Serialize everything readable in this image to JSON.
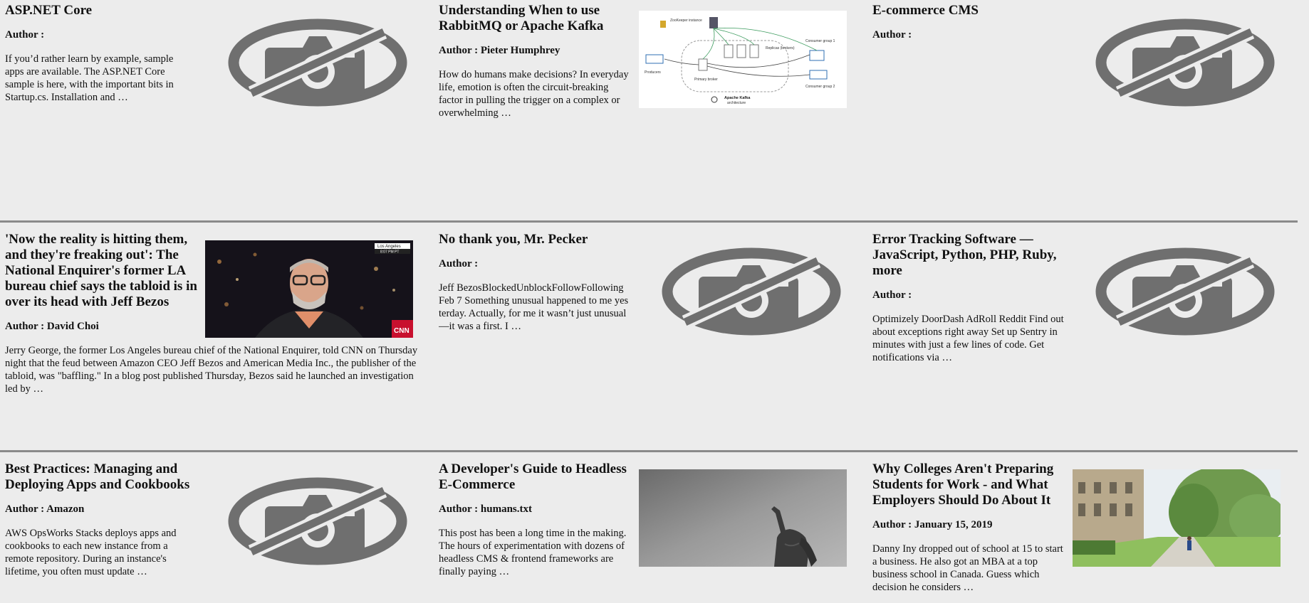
{
  "author_prefix": "Author : ",
  "cards": [
    {
      "title": "ASP.NET Core",
      "author": "Author :",
      "excerpt": "If you’d rather learn by example, sample apps are available. The ASP.NET Core sample is here, with the important bits in Startup.cs. Installation and …",
      "image": "no-photo-icon"
    },
    {
      "title": "Understanding When to use RabbitMQ or Apache Kafka",
      "author": "Author : Pieter Humphrey",
      "excerpt": "How do humans make decisions? In everyday life, emotion is often the circuit-breaking factor in pulling the trigger on a complex or overwhelming …",
      "image": "kafka-architecture-diagram",
      "diagram_labels": [
        "ZooKeeper instance",
        "Producers",
        "Replicas (brokers)",
        "Primary broker",
        "Consumer group 1",
        "Consumer group 2",
        "Apache Kafka",
        "architecture"
      ]
    },
    {
      "title": "E-commerce CMS",
      "author": "Author :",
      "excerpt": "",
      "image": "no-photo-icon"
    },
    {
      "title": "'Now the reality is hitting them, and they're freaking out': The National Enquirer's former LA bureau chief says the tabloid is in over its head with Jeff Bezos",
      "author": "Author : David Choi",
      "excerpt": "Jerry George, the former Los Angeles bureau chief of the National Enquirer, told CNN on Thursday night that the feud between Amazon CEO Jeff Bezos and American Media Inc., the publisher of the tabloid, was \"baffling.\" In a blog post published Thursday, Bezos said he launched an investigation led by …",
      "image": "news-interview-photo",
      "photo_labels": {
        "location": "Los Angeles",
        "time": "8:07 PM PT",
        "network": "CNN"
      }
    },
    {
      "title": "No thank you, Mr. Pecker",
      "author": "Author :",
      "excerpt": "Jeff BezosBlockedUnblockFollowFollowing Feb 7 Something unusual happened to me yesterday. Actually, for me it wasn’t just unusual—it was a first. I …",
      "image": "no-photo-icon"
    },
    {
      "title": "Error Tracking Software — JavaScript, Python, PHP, Ruby, more",
      "author": "Author :",
      "excerpt": "Optimizely DoorDash AdRoll Reddit Find out about exceptions right away Set up Sentry in minutes with just a few lines of code. Get notifications via …",
      "image": "no-photo-icon"
    },
    {
      "title": "Best Practices: Managing and Deploying Apps and Cookbooks",
      "author": "Author : Amazon",
      "excerpt": "AWS OpsWorks Stacks deploys apps and cookbooks to each new instance from a remote repository. During an instance's lifetime, you often must update …",
      "image": "no-photo-icon"
    },
    {
      "title": "A Developer's Guide to Headless E-Commerce",
      "author": "Author : humans.txt",
      "excerpt": "This post has been a long time in the making. The hours of experimentation with dozens of headless CMS & frontend frameworks are finally paying …",
      "image": "headless-statue-photo"
    },
    {
      "title": "Why Colleges Aren't Preparing Students for Work - and What Employers Should Do About It",
      "author": "Author : January 15, 2019",
      "excerpt": "Danny Iny dropped out of school at 15 to start a business. He also got an MBA at a top business school in Canada. Guess which decision he considers …",
      "image": "college-campus-photo"
    }
  ]
}
